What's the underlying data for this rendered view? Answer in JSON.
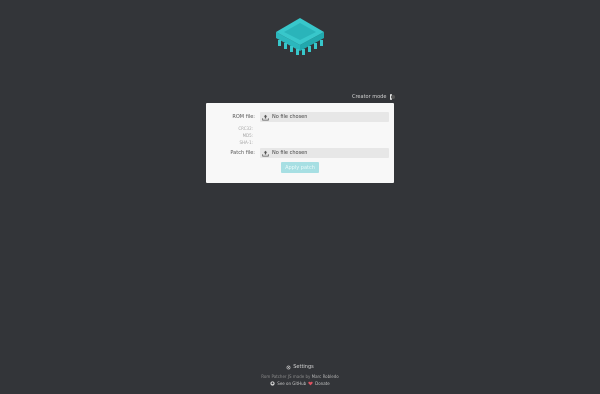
{
  "creator_mode": {
    "label": "Creator mode",
    "enabled": false
  },
  "rom": {
    "label": "ROM file:",
    "value": "No file chosen"
  },
  "checksums": [
    "CRC32:",
    "MD5:",
    "SHA-1:"
  ],
  "patch": {
    "label": "Patch file:",
    "value": "No file chosen"
  },
  "apply_label": "Apply patch",
  "footer": {
    "settings": "Settings",
    "credit_prefix": "Rom Patcher JS",
    "credit_made_by": "made by",
    "credit_author": "Marc Robledo",
    "github": "See on GitHub",
    "donate": "Donate"
  },
  "colors": {
    "accent": "#36c3c8",
    "background": "#333539",
    "panel": "#f8f8f8",
    "button": "#a7dfe3"
  }
}
